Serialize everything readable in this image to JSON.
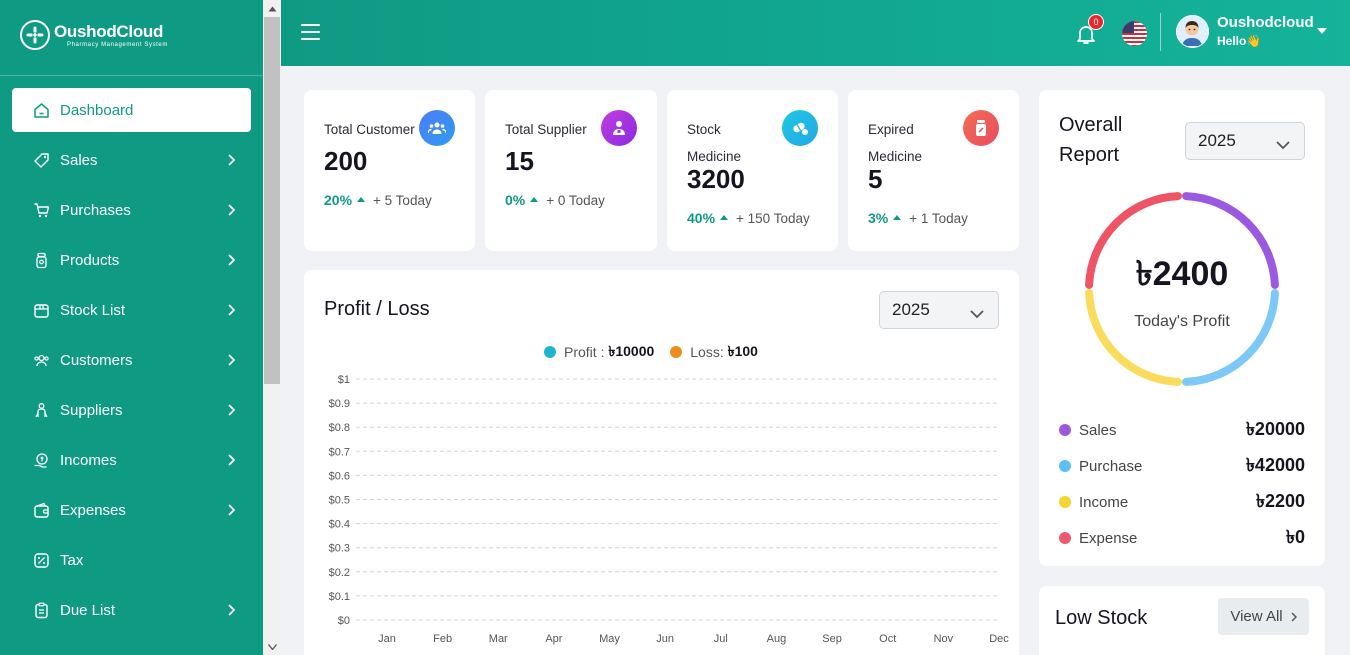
{
  "brand": {
    "name": "OushodCloud",
    "tagline": "Pharmacy Management System"
  },
  "sidebar": {
    "items": [
      {
        "label": "Dashboard",
        "icon": "home-icon"
      },
      {
        "label": "Sales",
        "icon": "tag-icon"
      },
      {
        "label": "Purchases",
        "icon": "cart-icon"
      },
      {
        "label": "Products",
        "icon": "bottle-icon"
      },
      {
        "label": "Stock List",
        "icon": "box-icon"
      },
      {
        "label": "Customers",
        "icon": "users-icon"
      },
      {
        "label": "Suppliers",
        "icon": "supplier-icon"
      },
      {
        "label": "Incomes",
        "icon": "money-icon"
      },
      {
        "label": "Expenses",
        "icon": "wallet-icon"
      },
      {
        "label": "Tax",
        "icon": "percent-icon"
      },
      {
        "label": "Due List",
        "icon": "clipboard-icon"
      }
    ]
  },
  "header": {
    "notification_count": "0",
    "user_name": "Oushodcloud",
    "user_greeting": "Hello👋"
  },
  "stats": [
    {
      "label": "Total Customer",
      "value": "200",
      "pct": "20%",
      "today": "+ 5 Today",
      "icon": "customers-icon"
    },
    {
      "label": "Total Supplier",
      "value": "15",
      "pct": "0%",
      "today": "+ 0 Today",
      "icon": "supplier-icon"
    },
    {
      "label": "Stock Medicine",
      "value": "3200",
      "pct": "40%",
      "today": "+ 150 Today",
      "icon": "pills-icon"
    },
    {
      "label": "Expired Medicine",
      "value": "5",
      "pct": "3%",
      "today": "+ 1 Today",
      "icon": "expired-icon"
    }
  ],
  "profit_loss": {
    "title": "Profit / Loss",
    "year": "2025",
    "legend": [
      {
        "label": "Profit :",
        "value": "৳10000",
        "color": "#1fb5d1"
      },
      {
        "label": "Loss:",
        "value": "৳100",
        "color": "#f08c1c"
      }
    ]
  },
  "chart_data": {
    "type": "line",
    "title": "",
    "categories": [
      "Jan",
      "Feb",
      "Mar",
      "Apr",
      "May",
      "Jun",
      "Jul",
      "Aug",
      "Sep",
      "Oct",
      "Nov",
      "Dec"
    ],
    "y_ticks": [
      "$1",
      "$0.9",
      "$0.8",
      "$0.7",
      "$0.6",
      "$0.5",
      "$0.4",
      "$0.3",
      "$0.2",
      "$0.1",
      "$0"
    ],
    "ylim": [
      0,
      1
    ],
    "grid": true,
    "series": []
  },
  "overall_report": {
    "title": "Overall Report",
    "year": "2025",
    "today_profit_value": "৳2400",
    "today_profit_label": "Today's Profit",
    "segment_colors": [
      "#9b59e0",
      "#7cc8f7",
      "#f9dc5c",
      "#ef5366"
    ],
    "breakdown": [
      {
        "label": "Sales",
        "value": "৳20000",
        "color": "#9b59e0"
      },
      {
        "label": "Purchase",
        "value": "৳42000",
        "color": "#5bc0f8"
      },
      {
        "label": "Income",
        "value": "৳2200",
        "color": "#f5d532"
      },
      {
        "label": "Expense",
        "value": "৳0",
        "color": "#ec5a70"
      }
    ]
  },
  "low_stock": {
    "title": "Low Stock",
    "view_all": "View All"
  }
}
